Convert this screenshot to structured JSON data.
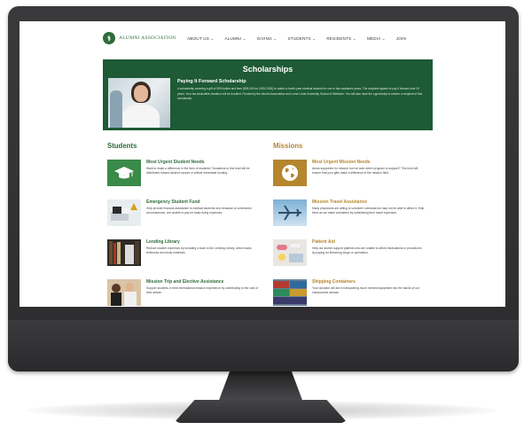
{
  "nav": {
    "logo_mark": "⚕",
    "logo_text": "ALUMNI ASSOCIATION",
    "menu": [
      "ABOUT US ⌄",
      "ALUMNI ⌄",
      "GIVING ⌄",
      "STUDENTS ⌄",
      "RESIDENTS ⌄",
      "MEDIA ⌄",
      "JOIN"
    ]
  },
  "hero": {
    "title": "Scholarships",
    "subtitle": "Paying It Forward Scholarship",
    "body": "A scholarship covering a gift of 90% tuition and fees ($26,000 for 2025-2026) to match a fourth-year medical student for one or two academic years. The recipient agrees to pay it forward over 20 years. Your tax-deductible donation will be doubled. Funded by the Alumni Association and Loma Linda University School of Medicine. You will also have the opportunity to mentor a recipient of this scholarship."
  },
  "students": {
    "title": "Students",
    "items": [
      {
        "title": "Most Urgent Student Needs",
        "body": "Want to make a difference in the lives of students? Donations to this fund will be distributed toward student causes or critical immediate funding."
      },
      {
        "title": "Emergency Student Fund",
        "body": "Help provide financial assistance to medical students who because of unforeseen circumstances, are unable to pay for basic living expenses."
      },
      {
        "title": "Lending Library",
        "body": "Reduce student expenses by donating a book to the Lending Library, which loans textbooks and study materials."
      },
      {
        "title": "Mission Trip and Elective Assistance",
        "body": "Support students in their international mission experience by contributing to the cost of their airfare."
      }
    ]
  },
  "missions": {
    "title": "Missions",
    "items": [
      {
        "title": "Most Urgent Mission Needs",
        "body": "Areas supported for mission but not sure which program to support? This fund will ensure that your gifts make a difference in the mission field."
      },
      {
        "title": "Mission Travel Assistance",
        "body": "Many physicians are willing to volunteer overseas but may not be able to afford it. Help them as we make volunteers by subsidizing their travel expenses."
      },
      {
        "title": "Patient Aid",
        "body": "Help our alumni support patients who are unable to afford medications or procedures by paying for lifesaving drugs or operations."
      },
      {
        "title": "Shipping Containers",
        "body": "Your donation will aid in transporting much needed equipment into the hands of our missionaries abroad."
      }
    ]
  },
  "colors": {
    "green": "#1e5a35",
    "accent_green": "#2f6b3a",
    "gold": "#b5862d",
    "bezel": "#2c2c2e"
  }
}
